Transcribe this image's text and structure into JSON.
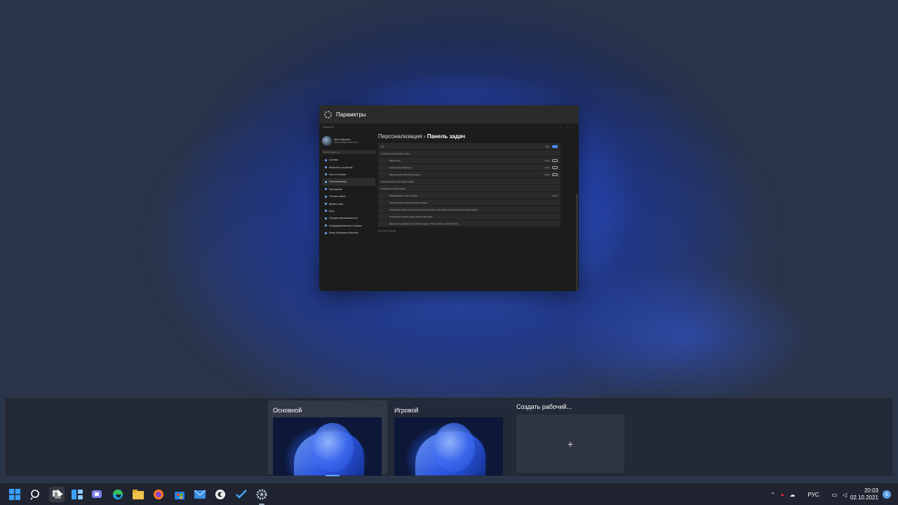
{
  "window_preview": {
    "title": "Параметры",
    "inner_title": "Параметры",
    "user_name": "Антон Карпенко",
    "user_email": "karpenko@outlook.com",
    "search_placeholder": "Найти параметр",
    "nav": [
      {
        "label": "Система",
        "active": false
      },
      {
        "label": "Bluetooth и устройства",
        "active": false
      },
      {
        "label": "Сеть и Интернет",
        "active": false
      },
      {
        "label": "Персонализация",
        "active": true
      },
      {
        "label": "Приложения",
        "active": false
      },
      {
        "label": "Учетные записи",
        "active": false
      },
      {
        "label": "Время и язык",
        "active": false
      },
      {
        "label": "Игры",
        "active": false
      },
      {
        "label": "Специальные возможности",
        "active": false
      },
      {
        "label": "Конфиденциальность и защита",
        "active": false
      },
      {
        "label": "Центр обновления Windows",
        "active": false
      }
    ],
    "breadcrumb_parent": "Персонализация",
    "breadcrumb_separator": "›",
    "breadcrumb_current": "Панель задач",
    "rows": [
      {
        "label": "Чат",
        "value": "Вкл.",
        "toggle_on": true,
        "sub": false
      },
      {
        "label": "Угловые значки панели задач",
        "value": "",
        "toggle_on": null,
        "sub": false
      },
      {
        "label": "Меню пера",
        "value": "Откл.",
        "toggle_on": false,
        "sub": true
      },
      {
        "label": "Сенсорная клавиатура",
        "value": "Откл.",
        "toggle_on": false,
        "sub": true
      },
      {
        "label": "Виртуальная сенсорная панель",
        "value": "Откл.",
        "toggle_on": false,
        "sub": true
      },
      {
        "label": "Переполнение угла панели задач",
        "value": "",
        "toggle_on": null,
        "sub": false
      },
      {
        "label": "Поведение панели задач",
        "value": "",
        "toggle_on": null,
        "sub": false
      },
      {
        "label": "Выравнивание панели задач",
        "value": "Слева",
        "toggle_on": null,
        "sub": true
      },
      {
        "label": "Автоматически скрывать панель задач",
        "value": "",
        "toggle_on": null,
        "sub": true
      },
      {
        "label": "Показывать эмблемы (счетчик непрочитанных сообщений) на приложениях панели задач",
        "value": "",
        "toggle_on": null,
        "sub": true
      },
      {
        "label": "Показывать панель задач на всех дисплеях",
        "value": "",
        "toggle_on": null,
        "sub": true
      },
      {
        "label": "Щелкните в дальнем углу панели задач, чтобы показать рабочий стол",
        "value": "",
        "toggle_on": null,
        "sub": true
      }
    ],
    "footer_link": "Получить помощь"
  },
  "task_view": {
    "desktops": [
      {
        "label": "Основной",
        "selected": true
      },
      {
        "label": "Игровой",
        "selected": false
      }
    ],
    "new_desktop_label": "Создать рабочий...",
    "new_desktop_plus": "+"
  },
  "taskbar": {
    "icons": [
      "windows-start-icon",
      "search-icon",
      "task-view-icon",
      "widgets-icon",
      "teams-chat-icon",
      "edge-icon",
      "file-explorer-icon",
      "firefox-icon",
      "store-icon",
      "mail-icon",
      "ccleaner-icon",
      "todo-icon",
      "settings-icon"
    ],
    "language": "РУС",
    "time": "20:03",
    "date": "02.10.2021",
    "notification_count": "6"
  },
  "colors": {
    "accent": "#4c8dff",
    "taskbar_bg": "#1f2430"
  }
}
